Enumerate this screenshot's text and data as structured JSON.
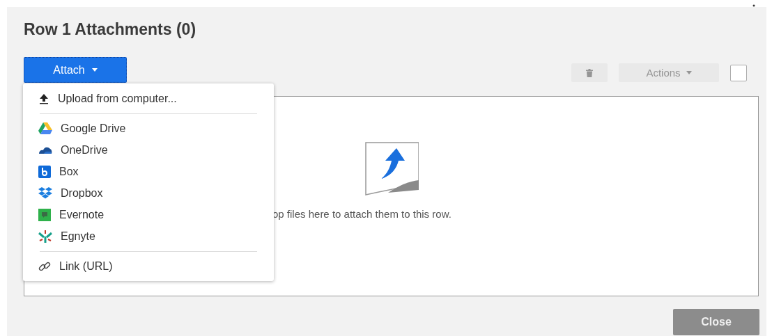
{
  "dialog": {
    "title": "Row 1 Attachments (0)"
  },
  "attach_button": {
    "label": "Attach",
    "expanded": true
  },
  "toolbar": {
    "actions_label": "Actions",
    "delete_disabled": true,
    "actions_disabled": true,
    "select_all_checked": false
  },
  "attach_menu": {
    "groups": [
      [
        {
          "kind": "upload",
          "label": "Upload from computer..."
        }
      ],
      [
        {
          "kind": "google-drive",
          "label": "Google Drive"
        },
        {
          "kind": "onedrive",
          "label": "OneDrive"
        },
        {
          "kind": "box",
          "label": "Box"
        },
        {
          "kind": "dropbox",
          "label": "Dropbox"
        },
        {
          "kind": "evernote",
          "label": "Evernote"
        },
        {
          "kind": "egnyte",
          "label": "Egnyte"
        }
      ],
      [
        {
          "kind": "link",
          "label": "Link (URL)"
        }
      ]
    ]
  },
  "drop_zone": {
    "hint": "op files here to attach them to this row."
  },
  "close_button": {
    "label": "Close"
  }
}
